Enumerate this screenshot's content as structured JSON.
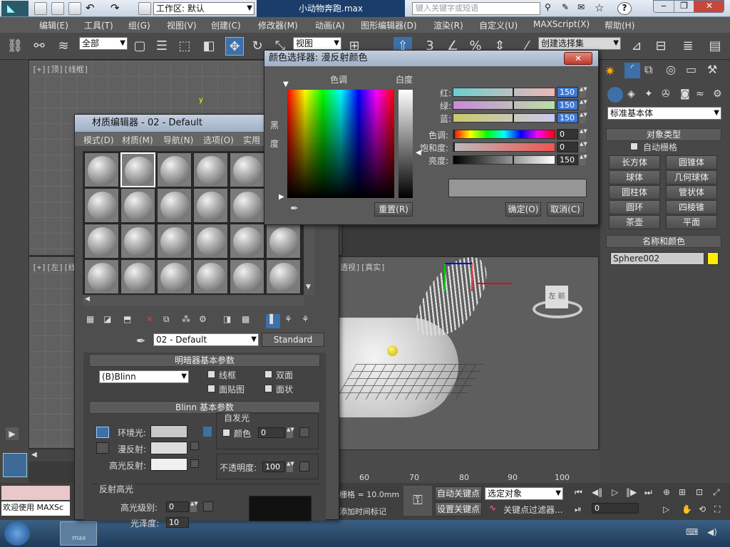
{
  "app": {
    "workspace_label": "工作区: 默认",
    "file_title": "小动物奔跑.max",
    "search_placeholder": "键入关键字或短语"
  },
  "menu": [
    "编辑(E)",
    "工具(T)",
    "组(G)",
    "视图(V)",
    "创建(C)",
    "修改器(M)",
    "动画(A)",
    "图形编辑器(D)",
    "渲染(R)",
    "自定义(U)",
    "MAXScript(X)",
    "帮助(H)"
  ],
  "toolbar": {
    "filter": "全部",
    "refcoord": "视图",
    "selection_set": "创建选择集"
  },
  "viewports": {
    "top_label": "[+][顶][线框]",
    "left_label": "[+][左][线",
    "persp_label": "透视][真实]",
    "cube_label": "左 前"
  },
  "command_panel": {
    "category": "标准基本体",
    "object_type_title": "对象类型",
    "autogrid": "自动栅格",
    "buttons": [
      "长方体",
      "圆锥体",
      "球体",
      "几何球体",
      "圆柱体",
      "管状体",
      "圆环",
      "四棱锥",
      "茶壶",
      "平面"
    ],
    "name_color_title": "名称和颜色",
    "object_name": "Sphere002",
    "object_color": "#ffee00"
  },
  "material_editor": {
    "title": "材质编辑器 - 02 - Default",
    "menu": [
      "模式(D)",
      "材质(M)",
      "导航(N)",
      "选项(O)",
      "实用"
    ],
    "material_name": "02 - Default",
    "material_type": "Standard",
    "shader_rollout": "明暗器基本参数",
    "shader": "(B)Blinn",
    "wire": "线框",
    "two_sided": "双面",
    "face_map": "面贴图",
    "faceted": "面状",
    "blinn_rollout": "Blinn 基本参数",
    "self_illum": "自发光",
    "self_illum_color": "颜色",
    "self_illum_value": "0",
    "ambient": "环境光:",
    "diffuse": "漫反射:",
    "specular": "高光反射:",
    "opacity": "不透明度:",
    "opacity_value": "100",
    "spec_highlights": "反射高光",
    "spec_level": "高光级别:",
    "spec_level_value": "0",
    "glossiness": "光泽度:",
    "glossiness_value": "10",
    "ambient_color": "#c8c8c8",
    "diffuse_color": "#dcdcdc",
    "specular_color": "#f0f0f0"
  },
  "color_picker": {
    "title": "颜色选择器: 漫反射颜色",
    "hue_label": "色调",
    "whiteness_label": "白度",
    "black_label": "黑",
    "degree_label": "度",
    "rows": [
      {
        "label": "红:",
        "value": "150"
      },
      {
        "label": "绿:",
        "value": "150"
      },
      {
        "label": "蓝:",
        "value": "150"
      },
      {
        "label": "色调:",
        "value": "0"
      },
      {
        "label": "饱和度:",
        "value": "0"
      },
      {
        "label": "亮度:",
        "value": "150"
      }
    ],
    "reset": "重置(R)",
    "ok": "确定(O)",
    "cancel": "取消(C)",
    "current_color": "#969696"
  },
  "timeline": {
    "ticks": [
      "60",
      "70",
      "80",
      "90",
      "100"
    ],
    "grid_text": "栅格 = 10.0mm",
    "time_tag": "添加时间标记",
    "auto_key": "自动关键点",
    "set_key": "设置关键点",
    "selected": "选定对象",
    "key_filter": "关键点过滤器...",
    "frame": "0"
  },
  "status": {
    "welcome": "欢迎使用 MAXSc"
  },
  "taskbar": {
    "app_label": "max"
  }
}
